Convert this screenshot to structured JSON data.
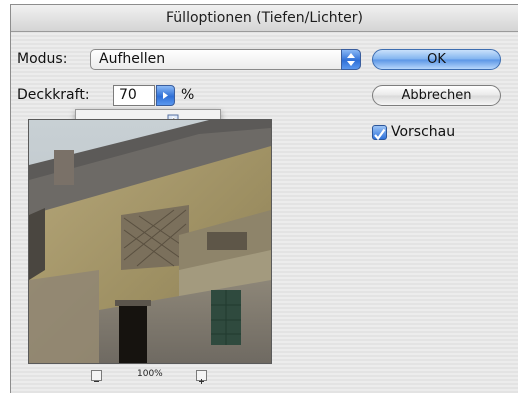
{
  "dialog": {
    "title": "Fülloptionen (Tiefen/Lichter)"
  },
  "mode": {
    "label": "Modus:",
    "value": "Aufhellen"
  },
  "opacity": {
    "label": "Deckkraft:",
    "value": "70",
    "unit": "%",
    "slider_fraction": 0.7
  },
  "buttons": {
    "ok": "OK",
    "cancel": "Abbrechen"
  },
  "preview_toggle": {
    "label": "Vorschau",
    "checked": true
  },
  "zoom": {
    "level": "100%",
    "zoom_out_icon": "minus-icon",
    "zoom_in_icon": "plus-icon"
  },
  "colors": {
    "accent": "#3a7be0",
    "dialog_bg": "#ececec"
  }
}
